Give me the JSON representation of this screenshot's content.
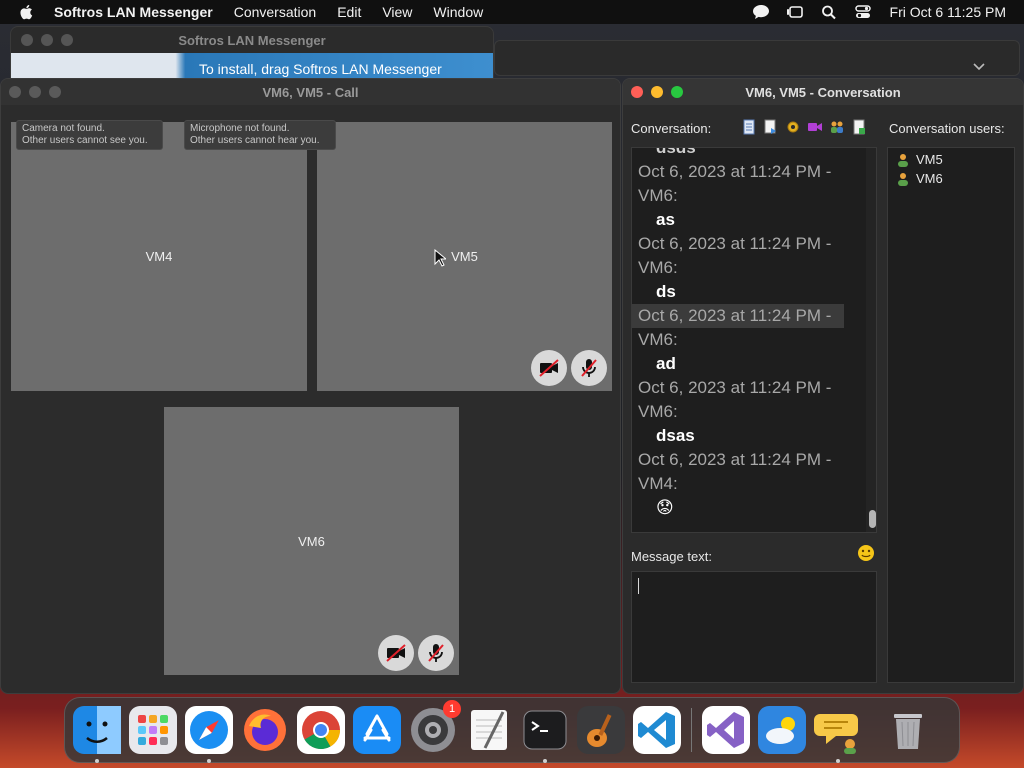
{
  "menubar": {
    "app_name": "Softros LAN Messenger",
    "menus": [
      "Conversation",
      "Edit",
      "View",
      "Window"
    ],
    "clock": "Fri Oct 6  11:25 PM"
  },
  "installer_window": {
    "title": "Softros LAN Messenger",
    "banner_text": "To install, drag Softros LAN Messenger"
  },
  "call_window": {
    "title": "VM6, VM5 - Call",
    "tooltips": {
      "camera_line1": "Camera not found.",
      "camera_line2": "Other users cannot see you.",
      "mic_line1": "Microphone not found.",
      "mic_line2": "Other users cannot hear you."
    },
    "tiles": [
      "VM4",
      "VM5",
      "VM6"
    ]
  },
  "conversation_window": {
    "title": "VM6, VM5 - Conversation",
    "conversation_label": "Conversation:",
    "users_label": "Conversation users:",
    "message_label": "Message text:",
    "messages": [
      {
        "head": "",
        "body": "dsds"
      },
      {
        "head1": "Oct 6, 2023 at 11:24 PM -",
        "head2": "VM6:",
        "body": "as"
      },
      {
        "head1": "Oct 6, 2023 at 11:24 PM -",
        "head2": "VM6:",
        "body": "ds"
      },
      {
        "head1": "Oct 6, 2023 at 11:24 PM -",
        "head2": "VM6:",
        "body": "ad"
      },
      {
        "head1": "Oct 6, 2023 at 11:24 PM -",
        "head2": "VM6:",
        "body": "dsas"
      },
      {
        "head1": "Oct 6, 2023 at 11:24 PM -",
        "head2": "VM4:",
        "body": "😟"
      }
    ],
    "users": [
      "VM5",
      "VM6"
    ]
  },
  "dock": {
    "items": [
      "Finder",
      "Launchpad",
      "Safari",
      "Firefox",
      "Chrome",
      "App Store",
      "System Settings",
      "TextEdit",
      "Terminal",
      "GarageBand",
      "Visual Studio Code",
      "Visual Studio",
      "Weather",
      "Softros LAN Messenger",
      "Trash"
    ],
    "settings_badge": "1"
  },
  "colors": {
    "accent_red": "#ff5f57",
    "accent_yellow": "#febc2e",
    "accent_green": "#28c840",
    "tile_gray": "#6d6d6d"
  }
}
